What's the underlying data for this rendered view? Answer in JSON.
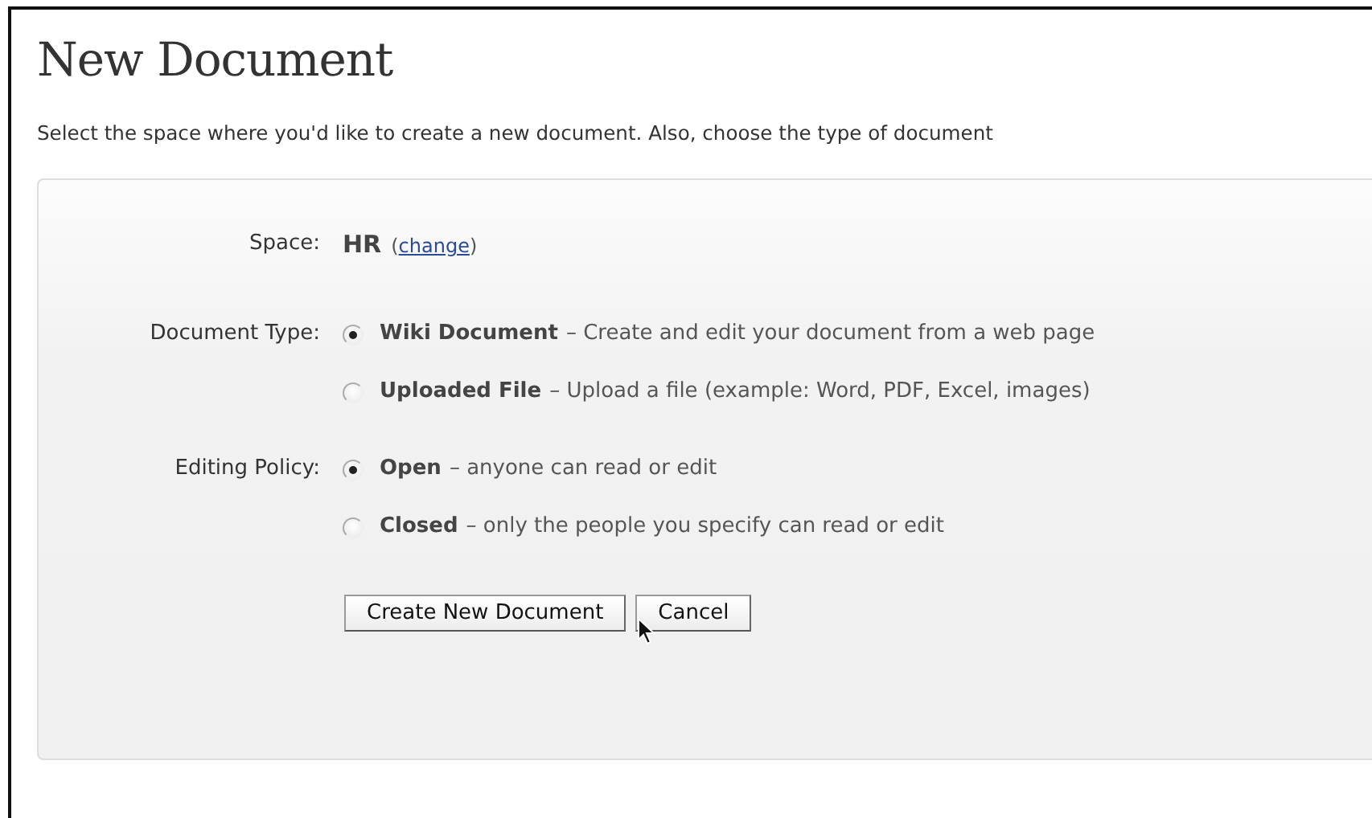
{
  "title": "New Document",
  "intro": "Select the space where you'd like to create a new document. Also, choose the type of document",
  "space": {
    "label": "Space:",
    "value": "HR",
    "open_paren": "(",
    "link": "change",
    "close_paren": ")"
  },
  "groups": [
    {
      "label": "Document Type:",
      "options": [
        {
          "name": "Wiki Document",
          "description": "– Create and edit your document from a web page",
          "selected": true
        },
        {
          "name": "Uploaded File",
          "description": "– Upload a file (example: Word, PDF, Excel, images)",
          "selected": false
        }
      ]
    },
    {
      "label": "Editing Policy:",
      "options": [
        {
          "name": "Open",
          "description": "– anyone can read or edit",
          "selected": true
        },
        {
          "name": "Closed",
          "description": "– only the people you specify can read or edit",
          "selected": false
        }
      ]
    }
  ],
  "buttons": [
    "Create New Document",
    "Cancel"
  ]
}
